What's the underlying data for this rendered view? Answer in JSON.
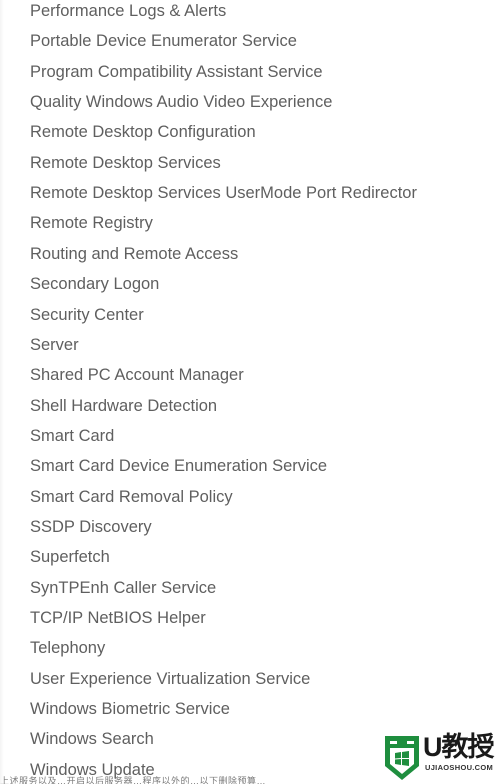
{
  "services": [
    "Performance Logs & Alerts",
    "Portable Device Enumerator Service",
    "Program Compatibility Assistant Service",
    "Quality Windows Audio Video Experience",
    "Remote Desktop Configuration",
    "Remote Desktop Services",
    "Remote Desktop Services UserMode Port Redirector",
    "Remote Registry",
    "Routing and Remote Access",
    "Secondary Logon",
    "Security Center",
    "Server",
    "Shared PC Account Manager",
    "Shell Hardware Detection",
    "Smart Card",
    "Smart Card Device Enumeration Service",
    "Smart Card Removal Policy",
    "SSDP Discovery",
    "Superfetch",
    "SynTPEnh Caller Service",
    "TCP/IP NetBIOS Helper",
    "Telephony",
    "User Experience Virtualization Service",
    "Windows Biometric Service",
    "Windows Search",
    "Windows Update"
  ],
  "caption": "上述服务以及…开启以后服务器…程序以外的…以下删除预算…",
  "watermark": {
    "brand": "U教授",
    "domain": "UJIAOSHOU.COM",
    "icon": "shield-windows-icon",
    "color": "#1e8e3e"
  }
}
